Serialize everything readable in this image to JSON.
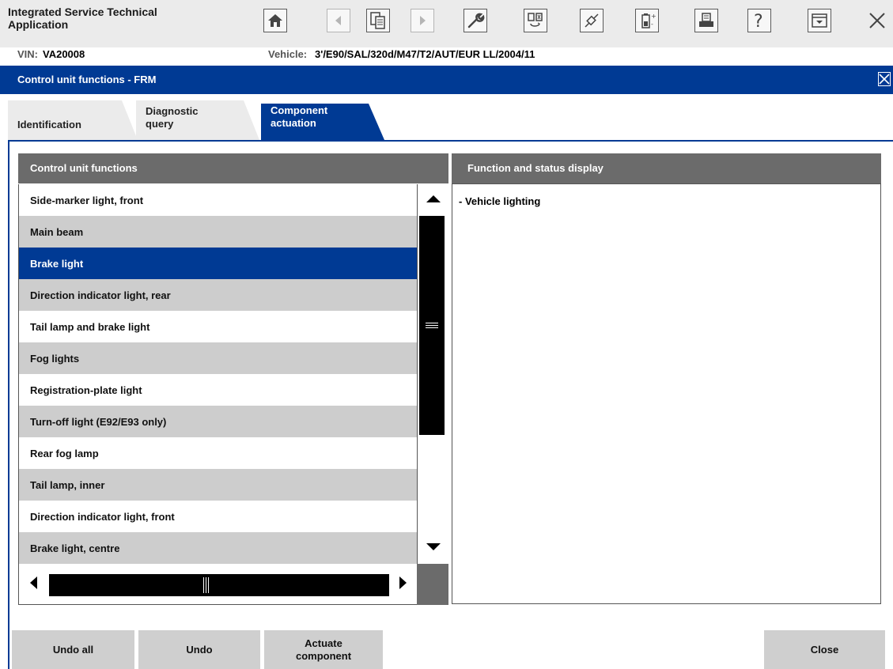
{
  "app": {
    "title": "Integrated Service Technical Application"
  },
  "toolbar": {
    "icons": [
      {
        "name": "home-icon",
        "disabled": false
      },
      {
        "name": "back-arrow-icon",
        "disabled": true
      },
      {
        "name": "documents-icon",
        "disabled": false
      },
      {
        "name": "forward-arrow-icon",
        "disabled": true
      },
      {
        "name": "wrench-icon",
        "disabled": false
      },
      {
        "name": "ecu-exchange-icon",
        "disabled": false
      },
      {
        "name": "connection-plug-icon",
        "disabled": false
      },
      {
        "name": "battery-icon",
        "disabled": false
      },
      {
        "name": "printer-icon",
        "disabled": false
      },
      {
        "name": "help-icon",
        "disabled": false
      },
      {
        "name": "minimize-icon",
        "disabled": false
      },
      {
        "name": "exit-icon",
        "disabled": false
      }
    ]
  },
  "vehicle": {
    "vin_label": "VIN:",
    "vin": "VA20008",
    "vehicle_label": "Vehicle:",
    "vehicle": "3'/E90/SAL/320d/M47/T2/AUT/EUR LL/2004/11"
  },
  "window": {
    "title": "Control unit functions - FRM"
  },
  "tabs": [
    {
      "label": "Identification",
      "active": false
    },
    {
      "label": "Diagnostic\nquery",
      "active": false
    },
    {
      "label": "Component\nactuation",
      "active": true
    }
  ],
  "left_panel": {
    "header": "Control unit functions",
    "items": [
      "Side-marker light, front",
      "Main beam",
      "Brake light",
      "Direction indicator light, rear",
      "Tail lamp and brake light",
      "Fog lights",
      "Registration-plate light",
      "Turn-off light (E92/E93 only)",
      "Rear fog lamp",
      "Tail lamp, inner",
      "Direction indicator light, front",
      "Brake light, centre"
    ],
    "selected_index": 2
  },
  "right_panel": {
    "header": "Function and status display",
    "status": "- Vehicle lighting"
  },
  "buttons": {
    "undo_all": "Undo all",
    "undo": "Undo",
    "actuate": "Actuate\ncomponent",
    "close": "Close"
  },
  "colors": {
    "accent": "#003a94",
    "header_gray": "#6b6b6b",
    "row_alt": "#cdcdcd",
    "toolbar_bg": "#ebebeb"
  }
}
